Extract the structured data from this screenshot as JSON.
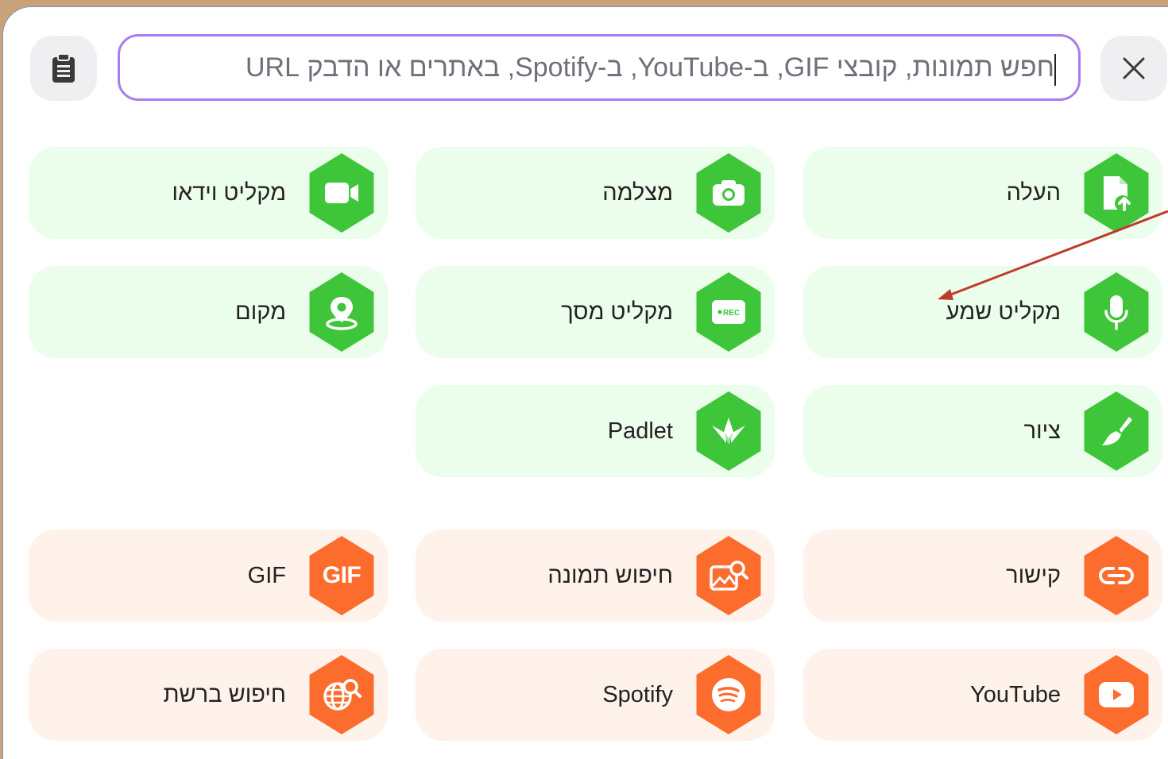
{
  "search": {
    "placeholder": "חפש תמונות, קובצי GIF, ב-YouTube, ב-Spotify, באתרים או הדבק URL"
  },
  "toolbar": {
    "clipboard_icon": "clipboard-icon",
    "close_icon": "close-icon"
  },
  "tiles": {
    "upload": {
      "label": "העלה",
      "icon": "upload-file-icon"
    },
    "camera": {
      "label": "מצלמה",
      "icon": "camera-icon"
    },
    "video_recorder": {
      "label": "מקליט וידאו",
      "icon": "video-camera-icon"
    },
    "audio_recorder": {
      "label": "מקליט שמע",
      "icon": "microphone-icon"
    },
    "screen_recorder": {
      "label": "מקליט מסך",
      "icon": "screen-rec-icon"
    },
    "location": {
      "label": "מקום",
      "icon": "location-pin-icon"
    },
    "drawing": {
      "label": "ציור",
      "icon": "paintbrush-icon"
    },
    "padlet": {
      "label": "Padlet",
      "icon": "padlet-crane-icon"
    },
    "link": {
      "label": "קישור",
      "icon": "link-icon"
    },
    "image_search": {
      "label": "חיפוש תמונה",
      "icon": "image-search-icon"
    },
    "gif": {
      "label": "GIF",
      "icon": "gif-icon",
      "icon_text": "GIF"
    },
    "youtube": {
      "label": "YouTube",
      "icon": "youtube-play-icon"
    },
    "spotify": {
      "label": "Spotify",
      "icon": "spotify-icon"
    },
    "web_search": {
      "label": "חיפוש ברשת",
      "icon": "web-search-icon"
    }
  },
  "colors": {
    "green_bg": "#ebfdeb",
    "green_icon": "#3fc53a",
    "orange_bg": "#fff2ea",
    "orange_icon": "#fb6c2d",
    "search_border": "#a67cf0",
    "arrow": "#c0392b"
  }
}
